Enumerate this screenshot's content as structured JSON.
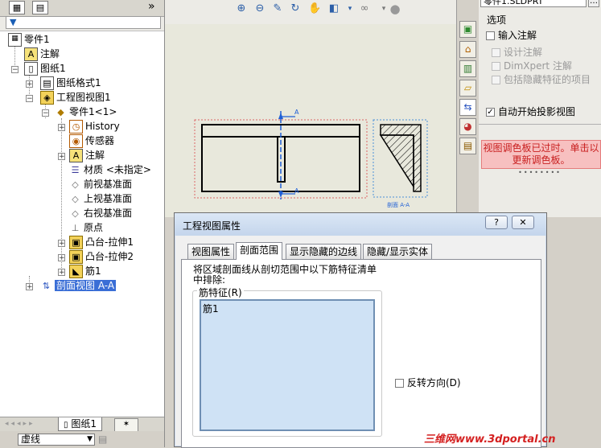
{
  "filter_label": "",
  "tree": {
    "root": "零件1",
    "annotations": "注解",
    "sheet": "图纸1",
    "sheet_format": "图纸格式1",
    "drawing_view": "工程图视图1",
    "part_ref": "零件1<1>",
    "history": "History",
    "sensors": "传感器",
    "part_annotations": "注解",
    "material": "材质 <未指定>",
    "front_plane": "前视基准面",
    "top_plane": "上视基准面",
    "right_plane": "右视基准面",
    "origin": "原点",
    "extrude1": "凸台-拉伸1",
    "extrude2": "凸台-拉伸2",
    "rib1": "筋1",
    "section_view": "剖面视图 A-A"
  },
  "bottom_tab": "图纸1",
  "linetype": "虚线",
  "right_panel": {
    "part_select": "零件1.SLDPRT",
    "options_title": "选项",
    "import_annotations": "输入注解",
    "design_annotations": "设计注解",
    "dimxpert": "DimXpert 注解",
    "hidden_features": "包括隐藏特征的项目",
    "auto_projection": "自动开始投影视图",
    "palette_message": "视图调色板已过时。单击以更新调色板。"
  },
  "right_options_state": {
    "import_annotations": false,
    "auto_projection": true
  },
  "drawing": {
    "section_label_top": "A",
    "section_label_bottom": "A",
    "section_view_caption": "剖面 A-A"
  },
  "dialog": {
    "title": "工程视图属性",
    "help": "?",
    "close": "✕",
    "tabs": [
      "视图属性",
      "剖面范围",
      "显示隐藏的边线",
      "隐藏/显示实体"
    ],
    "active_tab": 1,
    "instruction": "将区域剖面线从剖切范围中以下筋特征清单中排除:",
    "group_label": "筋特征(R)",
    "rib_items": [
      "筋1"
    ],
    "reverse_direction": "反转方向(D)"
  },
  "watermark": "三维网www.3dportal.cn",
  "colors": {
    "selection": "#3a6ed6",
    "palette_bg": "#f7c0c0",
    "palette_text": "#c81e1e",
    "list_bg": "#cfe2f5"
  }
}
